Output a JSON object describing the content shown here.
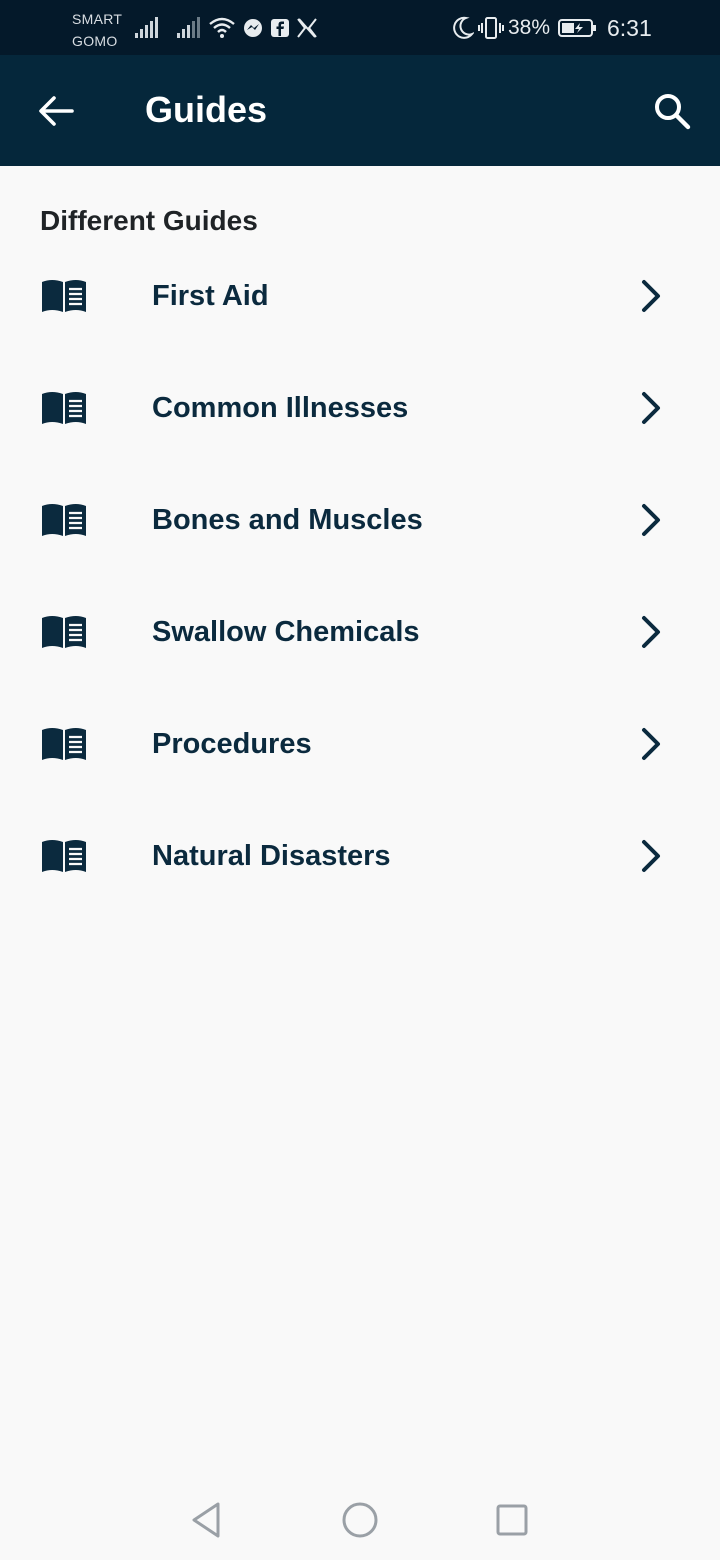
{
  "status_bar": {
    "carrier_line1": "SMART",
    "carrier_line2": "GOMO",
    "battery_percent": "38%",
    "time": "6:31",
    "icons": [
      "signal-icon",
      "signal-icon",
      "wifi-icon",
      "messenger-icon",
      "facebook-icon",
      "x-icon",
      "moon-icon",
      "vibrate-icon",
      "battery-icon"
    ]
  },
  "app_bar": {
    "title": "Guides",
    "back_icon": "back-arrow-icon",
    "search_icon": "search-icon"
  },
  "section": {
    "heading": "Different Guides"
  },
  "guides": [
    {
      "label": "First Aid",
      "icon": "book-icon"
    },
    {
      "label": "Common Illnesses",
      "icon": "book-icon"
    },
    {
      "label": "Bones and Muscles",
      "icon": "book-icon"
    },
    {
      "label": "Swallow Chemicals",
      "icon": "book-icon"
    },
    {
      "label": "Procedures",
      "icon": "book-icon"
    },
    {
      "label": "Natural Disasters",
      "icon": "book-icon"
    }
  ],
  "nav_bar": {
    "buttons": [
      "back-triangle-icon",
      "home-circle-icon",
      "recents-square-icon"
    ]
  },
  "colors": {
    "status_bar_bg": "#04192a",
    "app_bar_bg": "#05273b",
    "background": "#f9f9f9",
    "item_text": "#0b2a3e"
  }
}
